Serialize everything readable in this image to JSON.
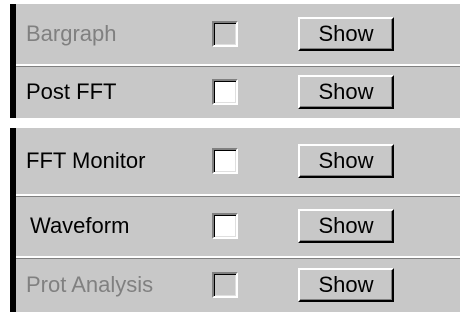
{
  "panels": [
    {
      "rows": [
        {
          "label": "Bargraph",
          "enabled": false,
          "checked": false,
          "button": "Show"
        },
        {
          "label": "Post FFT",
          "enabled": true,
          "checked": false,
          "button": "Show"
        }
      ]
    },
    {
      "rows": [
        {
          "label": "FFT Monitor",
          "enabled": true,
          "checked": false,
          "button": "Show"
        },
        {
          "label": "Waveform",
          "enabled": true,
          "checked": false,
          "button": "Show"
        },
        {
          "label": "Prot Analysis",
          "enabled": false,
          "checked": false,
          "button": "Show"
        }
      ]
    }
  ],
  "colors": {
    "panel_bg": "#c8c8c8",
    "disabled_text": "#808080",
    "text": "#000000"
  }
}
